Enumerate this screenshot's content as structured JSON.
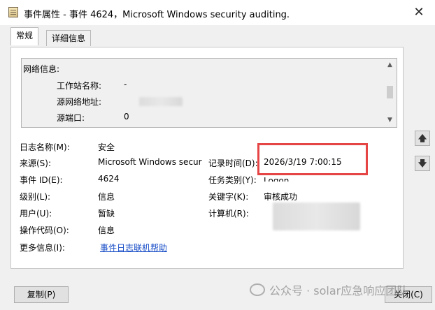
{
  "window": {
    "title": "事件属性 - 事件 4624，Microsoft Windows security auditing.",
    "close_glyph": "✕"
  },
  "tabs": [
    {
      "label": "常规",
      "active": true
    },
    {
      "label": "详细信息",
      "active": false
    }
  ],
  "description": {
    "section_header": "网络信息:",
    "rows": [
      {
        "label": "工作站名称:",
        "value": "-"
      },
      {
        "label": "源网络地址:",
        "value": ""
      },
      {
        "label": "源端口:",
        "value": "0"
      }
    ]
  },
  "properties": {
    "log_name": {
      "label": "日志名称(M):",
      "value": "安全"
    },
    "source": {
      "label": "来源(S):",
      "value": "Microsoft Windows secur"
    },
    "logged": {
      "label": "记录时间(D):",
      "value": "2026/3/19 7:00:15"
    },
    "event_id": {
      "label": "事件 ID(E):",
      "value": "4624"
    },
    "task_category": {
      "label": "任务类别(Y):",
      "value": "Logon"
    },
    "level": {
      "label": "级别(L):",
      "value": "信息"
    },
    "keywords": {
      "label": "关键字(K):",
      "value": "审核成功"
    },
    "user": {
      "label": "用户(U):",
      "value": "暂缺"
    },
    "computer": {
      "label": "计算机(R):",
      "value": ""
    },
    "opcode": {
      "label": "操作代码(O):",
      "value": "信息"
    },
    "more_info": {
      "label": "更多信息(I):",
      "link": "事件日志联机帮助"
    }
  },
  "buttons": {
    "copy": "复制(P)",
    "close": "关闭(C)"
  },
  "watermark": "公众号 · solar应急响应团队",
  "colors": {
    "highlight": "#e64545",
    "link": "#1a4fc7"
  }
}
